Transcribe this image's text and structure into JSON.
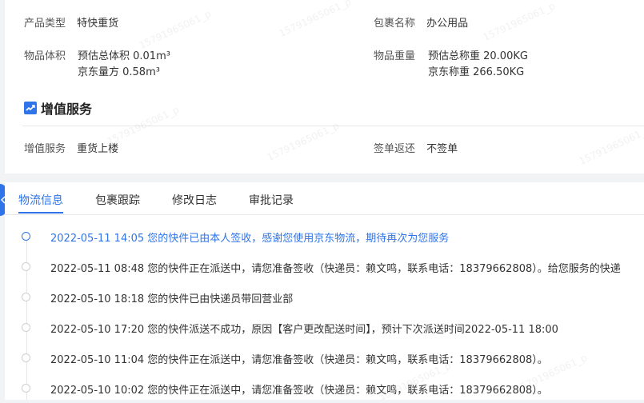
{
  "info": {
    "product_type_label": "产品类型",
    "product_type_value": "特快重货",
    "package_name_label": "包裹名称",
    "package_name_value": "办公用品",
    "volume_label": "物品体积",
    "volume_value_1": "预估总体积 0.01m³",
    "volume_value_2": "京东量方 0.58m³",
    "weight_label": "物品重量",
    "weight_value_1": "预估总称重 20.00KG",
    "weight_value_2": "京东称重 266.50KG"
  },
  "value_added": {
    "title": "增值服务",
    "service_label": "增值服务",
    "service_value": "重货上楼",
    "return_label": "签单返还",
    "return_value": "不签单"
  },
  "tabs": [
    {
      "label": "物流信息"
    },
    {
      "label": "包裹跟踪"
    },
    {
      "label": "修改日志"
    },
    {
      "label": "审批记录"
    }
  ],
  "timeline": [
    {
      "text": "2022-05-11 14:05 您的快件已由本人签收，感谢您使用京东物流，期待再次为您服务"
    },
    {
      "text": "2022-05-11 08:48 您的快件正在派送中，请您准备签收（快递员：赖文鸣，联系电话：18379662808）。给您服务的快递"
    },
    {
      "text": "2022-05-10 18:18 您的快件已由快递员带回营业部"
    },
    {
      "text": "2022-05-10 17:20 您的快件派送不成功，原因【客户更改配送时间】，预计下次派送时间2022-05-11 18:00"
    },
    {
      "text": "2022-05-10 11:04 您的快件正在派送中，请您准备签收（快递员：赖文鸣，联系电话：18379662808）。"
    },
    {
      "text": "2022-05-10 10:02 您的快件正在派送中，请您准备签收（快递员：赖文鸣，联系电话：18379662808）。"
    }
  ],
  "watermark": "15791965061_p",
  "colors": {
    "accent": "#2f74e8"
  }
}
